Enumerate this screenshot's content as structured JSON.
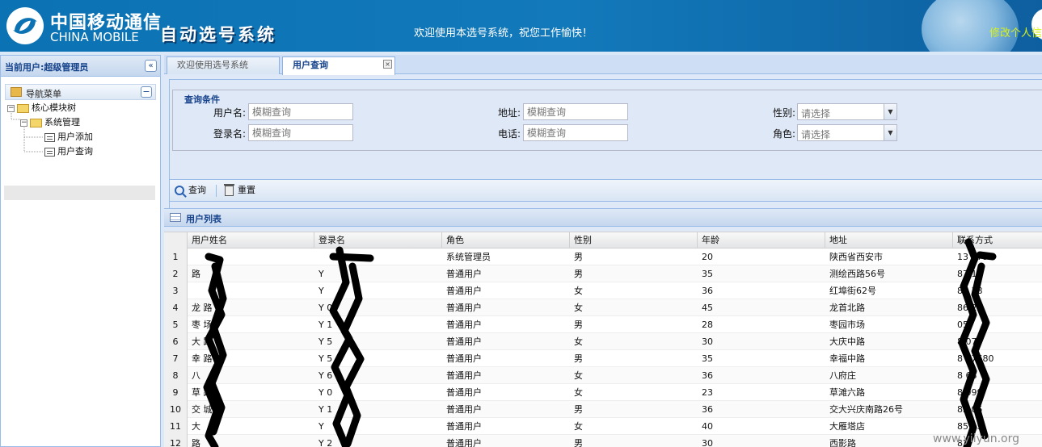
{
  "header": {
    "logo_cn": "中国移动通信",
    "logo_en": "CHINA MOBILE",
    "system_title": "自动选号系统",
    "welcome": "欢迎使用本选号系统，祝您工作愉快！",
    "edit_info_link": "修改个人信"
  },
  "sidebar": {
    "current_user": "当前用户:超级管理员",
    "collapse_icon": "«",
    "nav_title": "导航菜单",
    "nav_min_icon": "−",
    "tree": {
      "root": "核心模块树",
      "group": "系统管理",
      "items": [
        "用户添加",
        "用户查询"
      ]
    }
  },
  "tabs": [
    {
      "label": "欢迎使用选号系统",
      "active": false
    },
    {
      "label": "用户查询",
      "active": true,
      "close_icon": "×"
    }
  ],
  "query": {
    "legend": "查询条件",
    "fields": {
      "username_label": "用户名:",
      "username_placeholder": "模糊查询",
      "address_label": "地址:",
      "address_placeholder": "模糊查询",
      "gender_label": "性别:",
      "gender_value": "请选择",
      "login_label": "登录名:",
      "login_placeholder": "模糊查询",
      "phone_label": "电话:",
      "phone_placeholder": "模糊查询",
      "role_label": "角色:",
      "role_value": "请选择"
    },
    "toolbar": {
      "search_label": "查询",
      "reset_label": "重置"
    }
  },
  "grid": {
    "title": "用户列表",
    "columns": [
      "用户姓名",
      "登录名",
      "角色",
      "性别",
      "年龄",
      "地址",
      "联系方式"
    ],
    "rows": [
      {
        "no": "1",
        "name": "",
        "login": "",
        "role": "系统管理员",
        "gender": "男",
        "age": "20",
        "address": "陕西省西安市",
        "phone": "13     579"
      },
      {
        "no": "2",
        "name": "     路",
        "login": "Y",
        "role": "普通用户",
        "gender": "男",
        "age": "35",
        "address": "测绘西路56号",
        "phone": "87   13"
      },
      {
        "no": "3",
        "name": "",
        "login": "Y",
        "role": "普通用户",
        "gender": "女",
        "age": "36",
        "address": "红埠街62号",
        "phone": "87   38"
      },
      {
        "no": "4",
        "name": "龙    路",
        "login": "Y    0",
        "role": "普通用户",
        "gender": "女",
        "age": "45",
        "address": "龙首北路",
        "phone": "86   27"
      },
      {
        "no": "5",
        "name": "枣    场",
        "login": "Y    1",
        "role": "普通用户",
        "gender": "男",
        "age": "28",
        "address": "枣园市场",
        "phone": "    05"
      },
      {
        "no": "6",
        "name": "大    路",
        "login": "Y    5",
        "role": "普通用户",
        "gender": "女",
        "age": "30",
        "address": "大庆中路",
        "phone": "8    07"
      },
      {
        "no": "7",
        "name": "幸    路",
        "login": "Y    5",
        "role": "普通用户",
        "gender": "男",
        "age": "35",
        "address": "幸福中路",
        "phone": "8    77680"
      },
      {
        "no": "8",
        "name": "八",
        "login": "Y    6",
        "role": "普通用户",
        "gender": "女",
        "age": "36",
        "address": "八府庄",
        "phone": "8    68"
      },
      {
        "no": "9",
        "name": "草    路",
        "login": "Y    0",
        "role": "普通用户",
        "gender": "女",
        "age": "23",
        "address": "草滩六路",
        "phone": "8    099"
      },
      {
        "no": "10",
        "name": "交    城",
        "login": "Y    1",
        "role": "普通用户",
        "gender": "男",
        "age": "36",
        "address": "交大兴庆南路26号",
        "phone": "82    05"
      },
      {
        "no": "11",
        "name": "大",
        "login": "Y",
        "role": "普通用户",
        "gender": "女",
        "age": "40",
        "address": "大雁塔店",
        "phone": "85    25"
      },
      {
        "no": "12",
        "name": "    路",
        "login": "Y    2",
        "role": "普通用户",
        "gender": "男",
        "age": "30",
        "address": "西影路",
        "phone": "82"
      }
    ]
  },
  "watermark": "www.yiiyun.org",
  "colors": {
    "header_blue": "#0b72b3",
    "panel_border": "#99bbe8",
    "panel_title": "#15428b",
    "edit_link": "#d8f21a"
  }
}
